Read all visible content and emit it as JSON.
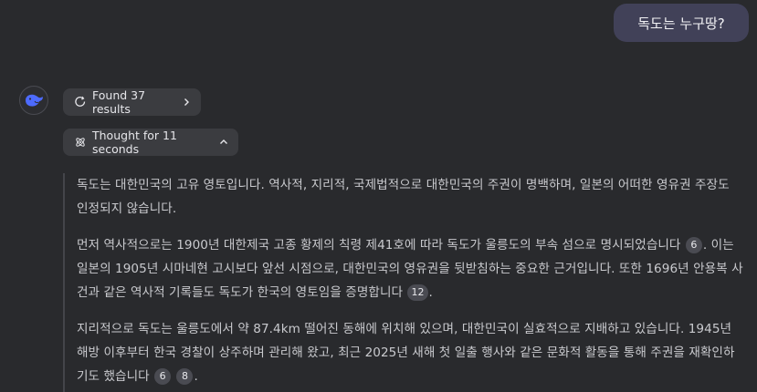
{
  "user_message": "독도는 누구땅?",
  "search_chip": {
    "label": "Found 37 results"
  },
  "thought_chip": {
    "label": "Thought for 11 seconds"
  },
  "thinking": {
    "paragraphs": [
      {
        "text": "독도는 대한민국의 고유 영토입니다. 역사적, 지리적, 국제법적으로 대한민국의 주권이 명백하며, 일본의 어떠한 영유권 주장도 인정되지 않습니다."
      },
      {
        "t1": "먼저 역사적으로는 1900년 대한제국 고종 황제의 칙령 제41호에 따라 독도가 울릉도의 부속 섬으로 명시되었습니다 ",
        "c1": "6",
        "t2": ". 이는 일본의 1905년 시마네현 고시보다 앞선 시점으로, 대한민국의 영유권을 뒷받침하는 중요한 근거입니다. 또한 1696년 안용복 사건과 같은 역사적 기록들도 독도가 한국의 영토임을 증명합니다 ",
        "c2": "12",
        "t3": "."
      },
      {
        "t1": "지리적으로 독도는 울릉도에서 약 87.4km 떨어진 동해에 위치해 있으며, 대한민국이 실효적으로 지배하고 있습니다. 1945년 해방 이후부터 한국 경찰이 상주하며 관리해 왔고, 최근 2025년 새해 첫 일출 행사와 같은 문화적 활동을 통해 주권을 재확인하기도 했습니다 ",
        "c1": "6",
        "c2": "8",
        "t2": "."
      }
    ]
  },
  "colors": {
    "background": "#292a2d",
    "user_bubble": "#414158",
    "chip": "#3b3c40",
    "avatar_accent": "#4d6bfe"
  },
  "icons": {
    "avatar": "whale-logo-icon",
    "search": "search-refresh-icon",
    "thought": "atom-icon"
  }
}
